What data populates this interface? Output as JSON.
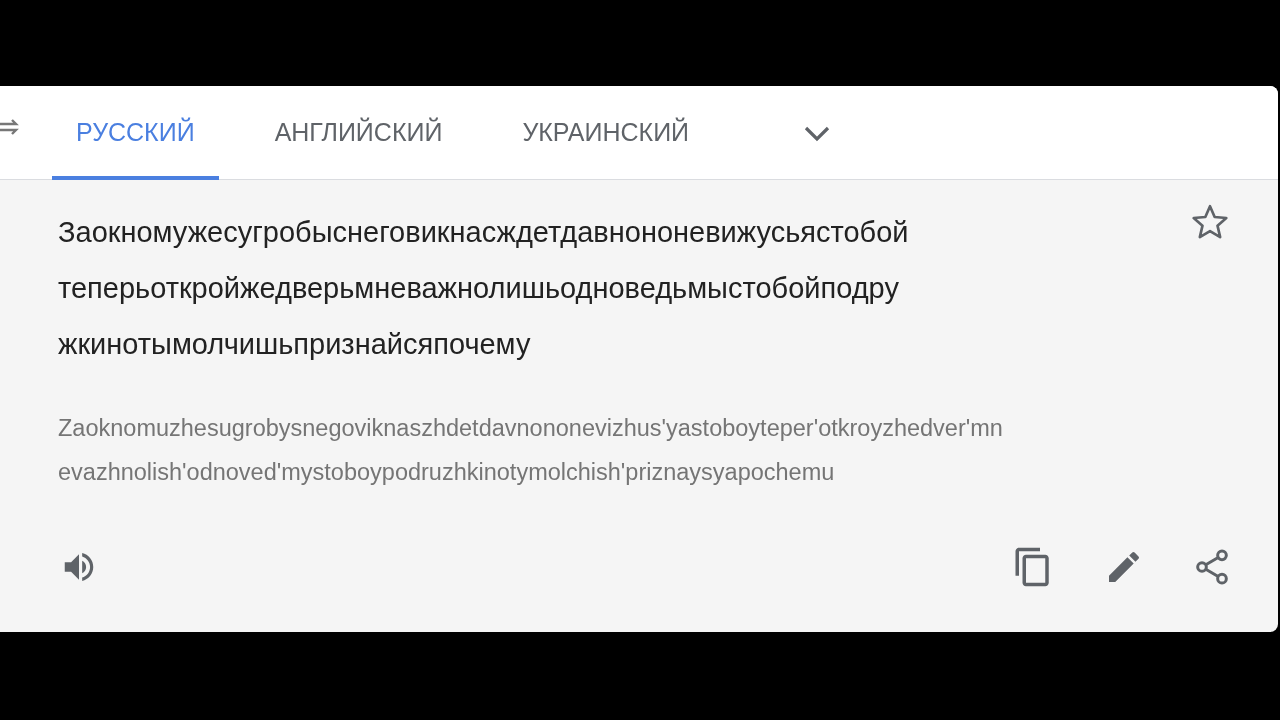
{
  "tabs": [
    {
      "label": "РУССКИЙ",
      "selected": true
    },
    {
      "label": "АНГЛИЙСКИЙ",
      "selected": false
    },
    {
      "label": "УКРАИНСКИЙ",
      "selected": false
    }
  ],
  "translation": {
    "lines": [
      "Заокномужесугробыснеговикнасждетдавнононевижусьястобой",
      "теперьоткройжедверьмневажнолишьодноведьмыстобойподру",
      "жкинотымолчишьпризнайсяпочему"
    ],
    "starred": false
  },
  "transliteration": {
    "lines": [
      "Zaoknomuzhesugrobysnegoviknaszhdetdavnononevizhus'yastoboyteper'otkroyzhedver'mn",
      "evazhnolish'odnoved'mystoboypodruzhkinotymolchish'priznaysyapochemu"
    ]
  }
}
